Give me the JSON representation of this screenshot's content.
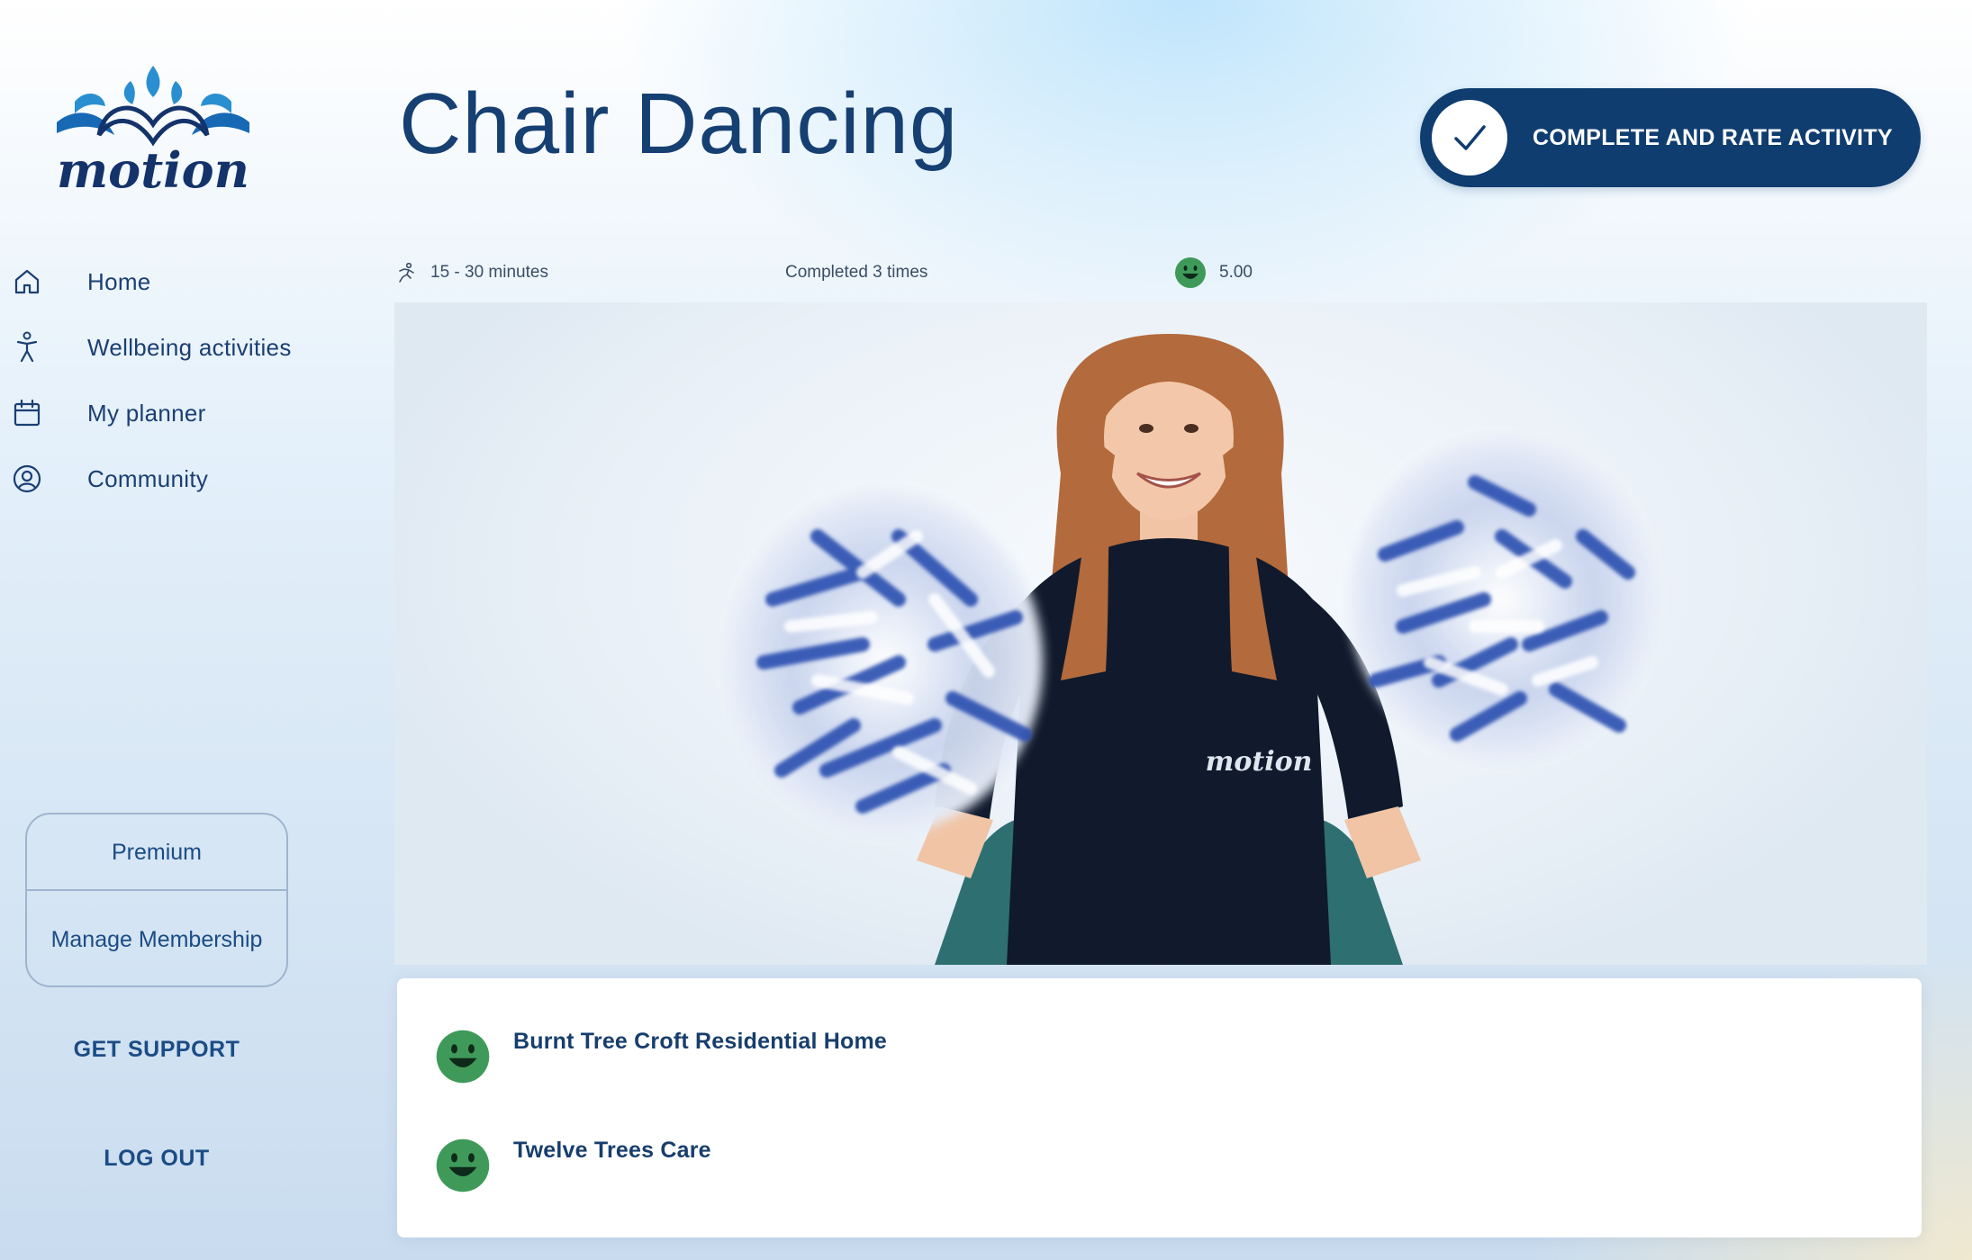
{
  "app": {
    "logo_text": "motion",
    "brand_color": "#0f3d70",
    "accent_color": "#2a8fd0"
  },
  "sidebar": {
    "items": [
      {
        "label": "Home",
        "icon": "home-icon"
      },
      {
        "label": "Wellbeing activities",
        "icon": "person-activity-icon"
      },
      {
        "label": "My planner",
        "icon": "calendar-icon"
      },
      {
        "label": "Community",
        "icon": "user-circle-icon"
      }
    ],
    "premium_label": "Premium",
    "manage_label": "Manage Membership",
    "support_label": "GET SUPPORT",
    "logout_label": "LOG OUT"
  },
  "activity": {
    "title": "Chair Dancing",
    "duration": "15 - 30 minutes",
    "completed": "Completed 3 times",
    "rating": "5.00",
    "rating_icon": "happy-face-icon",
    "complete_button_label": "COMPLETE AND RATE ACTIVITY",
    "complete_button_icon": "checkmark-icon",
    "shirt_logo_text": "motion"
  },
  "reviews": [
    {
      "name": "Burnt Tree Croft Residential Home",
      "icon": "happy-face-icon"
    },
    {
      "name": "Twelve Trees Care",
      "icon": "happy-face-icon"
    }
  ]
}
